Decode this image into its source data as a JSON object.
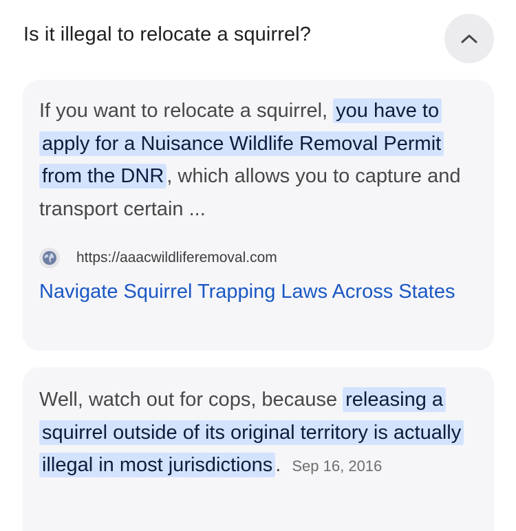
{
  "question": {
    "title": "Is it illegal to relocate a squirrel?",
    "collapse_icon": "chevron-up-icon"
  },
  "result_1": {
    "text_before": "If you want to relocate a squirrel,",
    "highlight": "you have to apply for a Nuisance Wildlife Removal Permit from the DNR",
    "text_after": ", which allows you to capture and transport certain ...",
    "source_icon": "globe-icon",
    "source_url": "https://aaacwildliferemoval.com",
    "link_title": "Navigate Squirrel Trapping Laws Across States"
  },
  "result_2": {
    "text_before": "Well, watch out for cops, because",
    "highlight": "releasing a squirrel outside of its original territory is actually illegal in most jurisdictions",
    "text_after": ".",
    "date": "Sep 16, 2016"
  },
  "colors": {
    "highlight_bg": "#d3e3fd",
    "link": "#1a57c4",
    "card_bg": "#f6f6f9"
  }
}
